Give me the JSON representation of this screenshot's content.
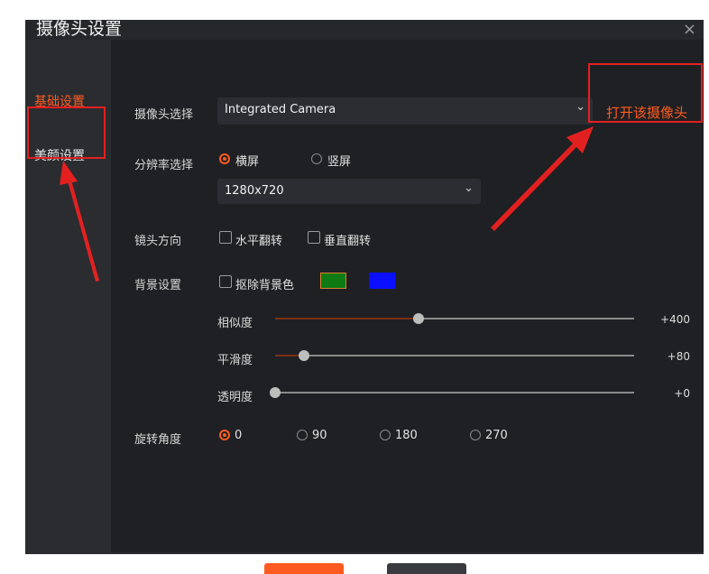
{
  "window": {
    "title": "摄像头设置",
    "close_glyph": "×"
  },
  "sidebar": {
    "items": [
      {
        "label": "基础设置"
      },
      {
        "label": "美颜设置"
      }
    ]
  },
  "camera": {
    "label": "摄像头选择",
    "value": "Integrated Camera",
    "open_label": "打开该摄像头"
  },
  "resolution": {
    "label": "分辨率选择",
    "orientation_options": [
      {
        "label": "横屏",
        "selected": true
      },
      {
        "label": "竖屏",
        "selected": false
      }
    ],
    "value": "1280x720"
  },
  "mirror": {
    "label": "镜头方向",
    "options": [
      {
        "label": "水平翻转",
        "checked": false
      },
      {
        "label": "垂直翻转",
        "checked": false
      }
    ]
  },
  "background": {
    "label": "背景设置",
    "remove_label": "抠除背景色",
    "colors": [
      "#0e7a14",
      "#0a10ff"
    ],
    "sliders": [
      {
        "label": "相似度",
        "value_text": "+400",
        "level": 0.4
      },
      {
        "label": "平滑度",
        "value_text": "+80",
        "level": 0.08
      },
      {
        "label": "透明度",
        "value_text": "+0",
        "level": 0.0
      }
    ]
  },
  "rotation": {
    "label": "旋转角度",
    "options": [
      {
        "label": "0",
        "selected": true
      },
      {
        "label": "90",
        "selected": false
      },
      {
        "label": "180",
        "selected": false
      },
      {
        "label": "270",
        "selected": false
      }
    ]
  },
  "colors": {
    "accent": "#ff5a1f",
    "annotation": "#e32020"
  }
}
